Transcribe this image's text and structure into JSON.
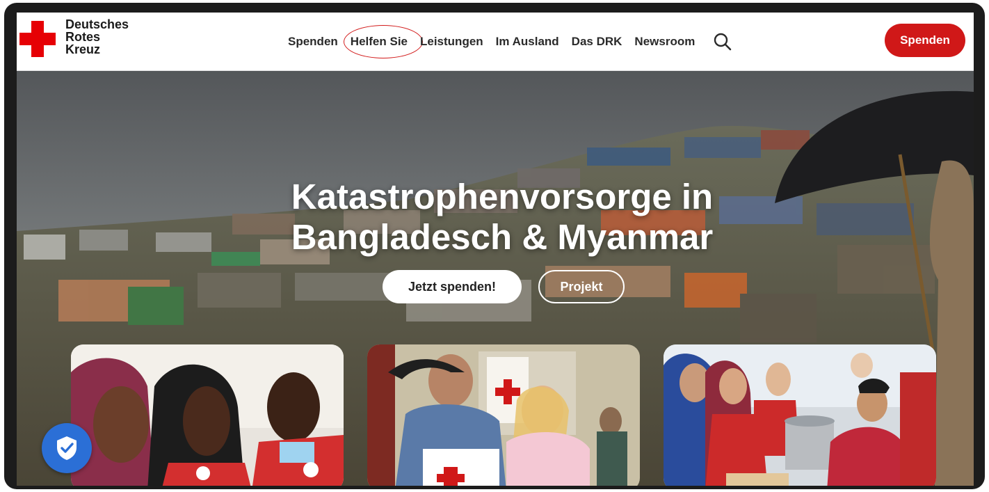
{
  "brand": {
    "name_line1": "Deutsches",
    "name_line2": "Rotes",
    "name_line3": "Kreuz",
    "color": "#e60005"
  },
  "nav": {
    "items": [
      {
        "label": "Spenden"
      },
      {
        "label": "Helfen Sie"
      },
      {
        "label": "Leistungen"
      },
      {
        "label": "Im Ausland"
      },
      {
        "label": "Das DRK"
      },
      {
        "label": "Newsroom"
      }
    ],
    "search_icon": "search-icon",
    "annotated_item": "Helfen Sie"
  },
  "header": {
    "donate_label": "Spenden",
    "donate_color": "#d01818"
  },
  "hero": {
    "title_line1": "Katastrophenvorsorge in",
    "title_line2": "Bangladesch & Myanmar",
    "primary_button": "Jetzt spenden!",
    "secondary_button": "Projekt"
  },
  "cards": [
    {
      "icon": "photo-aid-workers"
    },
    {
      "icon": "photo-relief-package"
    },
    {
      "icon": "photo-food-distribution"
    }
  ],
  "widgets": {
    "privacy_icon": "shield-check-icon",
    "privacy_color": "#2b6fd6"
  }
}
